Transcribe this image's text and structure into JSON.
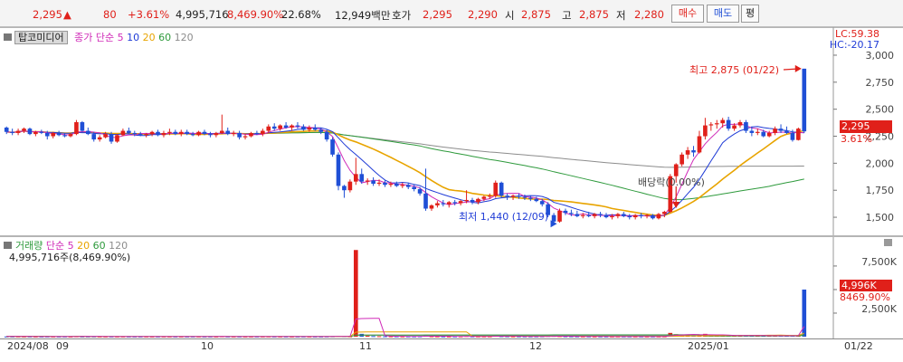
{
  "quote": {
    "price": "2,295",
    "change_arrow": "▲",
    "change": "80",
    "change_pct": "+3.61%",
    "volume": "4,995,716",
    "volume_ratio": "8,469.90%",
    "turnover_pct": "22.68%",
    "amount": "12,949백만",
    "hoga_label": "호가",
    "hoga_sell": "2,295",
    "hoga_buy": "2,290",
    "open_label": "시",
    "open": "2,875",
    "high_label": "고",
    "high": "2,875",
    "low_label": "저",
    "low": "2,280",
    "buy_label": "매수",
    "sell_label": "매도",
    "extra_label": "평"
  },
  "price_panel": {
    "stock_name": "탑코미디어",
    "legend_prefix": "종가 단순",
    "ma_periods": [
      "5",
      "10",
      "20",
      "60",
      "120"
    ],
    "lc": "LC:59.38",
    "hc": "HC:-20.17",
    "y_ticks": [
      "3,000",
      "2,750",
      "2,500",
      "2,250",
      "2,000",
      "1,750",
      "1,500"
    ],
    "current_price_tag": "2,295",
    "current_pct_tag": "3.61%",
    "high_annotation": "최고 2,875 (01/22)",
    "low_annotation": "최저 1,440 (12/09)",
    "dividend_annotation": "배당락(0.00%)"
  },
  "volume_panel": {
    "title": "거래량",
    "legend_prefix": "단순",
    "ma_periods": [
      "5",
      "20",
      "60",
      "120"
    ],
    "summary": "4,995,716주(8,469.90%)",
    "y_ticks": [
      "7,500K",
      "5,000K",
      "2,500K"
    ],
    "current_volume_tag": "4,996K",
    "current_ratio_tag": "8469.90%"
  },
  "x_axis": [
    "2024/08",
    "09",
    "10",
    "11",
    "12",
    "2025/01",
    "01/22"
  ],
  "colors": {
    "up": "#e0201a",
    "down": "#1f4fd6",
    "ma5": "#d02ab8",
    "ma10": "#1f3bd6",
    "ma20": "#e8a400",
    "ma60": "#2e9a3c",
    "ma120": "#8c8c8c"
  },
  "chart_data": {
    "type": "candlestick",
    "y_range": [
      1400,
      3050
    ],
    "candles": [
      [
        2330,
        2340,
        2270,
        2290
      ],
      [
        2290,
        2320,
        2260,
        2280
      ],
      [
        2280,
        2320,
        2260,
        2300
      ],
      [
        2300,
        2330,
        2280,
        2320
      ],
      [
        2320,
        2330,
        2260,
        2270
      ],
      [
        2270,
        2300,
        2250,
        2290
      ],
      [
        2290,
        2310,
        2270,
        2280
      ],
      [
        2280,
        2300,
        2220,
        2250
      ],
      [
        2250,
        2290,
        2230,
        2280
      ],
      [
        2280,
        2300,
        2250,
        2260
      ],
      [
        2260,
        2280,
        2240,
        2250
      ],
      [
        2250,
        2280,
        2240,
        2270
      ],
      [
        2270,
        2400,
        2260,
        2380
      ],
      [
        2380,
        2390,
        2290,
        2300
      ],
      [
        2300,
        2330,
        2260,
        2270
      ],
      [
        2270,
        2290,
        2200,
        2220
      ],
      [
        2220,
        2260,
        2200,
        2240
      ],
      [
        2240,
        2290,
        2230,
        2270
      ],
      [
        2270,
        2290,
        2180,
        2200
      ],
      [
        2200,
        2270,
        2190,
        2260
      ],
      [
        2260,
        2320,
        2250,
        2300
      ],
      [
        2300,
        2330,
        2270,
        2280
      ],
      [
        2280,
        2300,
        2250,
        2270
      ],
      [
        2270,
        2290,
        2250,
        2260
      ],
      [
        2260,
        2280,
        2240,
        2270
      ],
      [
        2270,
        2300,
        2250,
        2290
      ],
      [
        2290,
        2310,
        2250,
        2260
      ],
      [
        2260,
        2300,
        2240,
        2280
      ],
      [
        2280,
        2320,
        2260,
        2290
      ],
      [
        2290,
        2310,
        2260,
        2270
      ],
      [
        2270,
        2310,
        2250,
        2290
      ],
      [
        2290,
        2310,
        2260,
        2270
      ],
      [
        2270,
        2290,
        2250,
        2260
      ],
      [
        2260,
        2300,
        2250,
        2290
      ],
      [
        2290,
        2310,
        2260,
        2270
      ],
      [
        2270,
        2290,
        2240,
        2260
      ],
      [
        2260,
        2290,
        2240,
        2280
      ],
      [
        2280,
        2450,
        2270,
        2300
      ],
      [
        2300,
        2330,
        2260,
        2270
      ],
      [
        2270,
        2300,
        2250,
        2280
      ],
      [
        2280,
        2300,
        2220,
        2240
      ],
      [
        2240,
        2270,
        2220,
        2250
      ],
      [
        2250,
        2290,
        2240,
        2280
      ],
      [
        2280,
        2300,
        2260,
        2270
      ],
      [
        2270,
        2320,
        2250,
        2300
      ],
      [
        2300,
        2360,
        2280,
        2340
      ],
      [
        2340,
        2370,
        2300,
        2320
      ],
      [
        2320,
        2360,
        2300,
        2350
      ],
      [
        2350,
        2380,
        2320,
        2330
      ],
      [
        2330,
        2360,
        2300,
        2350
      ],
      [
        2350,
        2380,
        2320,
        2340
      ],
      [
        2340,
        2360,
        2300,
        2310
      ],
      [
        2310,
        2350,
        2290,
        2330
      ],
      [
        2330,
        2360,
        2300,
        2310
      ],
      [
        2310,
        2330,
        2270,
        2290
      ],
      [
        2290,
        2310,
        2200,
        2220
      ],
      [
        2220,
        2240,
        2060,
        2080
      ],
      [
        2080,
        2100,
        1750,
        1790
      ],
      [
        1790,
        1800,
        1680,
        1750
      ],
      [
        1750,
        1850,
        1730,
        1830
      ],
      [
        1830,
        2050,
        1800,
        1900
      ],
      [
        1900,
        1950,
        1810,
        1830
      ],
      [
        1830,
        1860,
        1800,
        1840
      ],
      [
        1840,
        1870,
        1790,
        1810
      ],
      [
        1810,
        1850,
        1790,
        1820
      ],
      [
        1820,
        1840,
        1780,
        1800
      ],
      [
        1800,
        1830,
        1780,
        1810
      ],
      [
        1810,
        1830,
        1780,
        1790
      ],
      [
        1790,
        1820,
        1770,
        1800
      ],
      [
        1800,
        1820,
        1760,
        1780
      ],
      [
        1780,
        1800,
        1740,
        1760
      ],
      [
        1760,
        1780,
        1700,
        1720
      ],
      [
        1720,
        1950,
        1560,
        1580
      ],
      [
        1580,
        1620,
        1560,
        1610
      ],
      [
        1610,
        1650,
        1590,
        1630
      ],
      [
        1630,
        1660,
        1600,
        1620
      ],
      [
        1620,
        1650,
        1590,
        1640
      ],
      [
        1640,
        1660,
        1610,
        1630
      ],
      [
        1630,
        1660,
        1610,
        1650
      ],
      [
        1650,
        1750,
        1630,
        1660
      ],
      [
        1660,
        1680,
        1620,
        1640
      ],
      [
        1640,
        1680,
        1620,
        1670
      ],
      [
        1670,
        1700,
        1650,
        1690
      ],
      [
        1690,
        1720,
        1670,
        1700
      ],
      [
        1700,
        1840,
        1680,
        1820
      ],
      [
        1820,
        1830,
        1680,
        1700
      ],
      [
        1700,
        1720,
        1660,
        1690
      ],
      [
        1690,
        1710,
        1660,
        1700
      ],
      [
        1700,
        1720,
        1670,
        1690
      ],
      [
        1690,
        1710,
        1660,
        1680
      ],
      [
        1680,
        1700,
        1650,
        1670
      ],
      [
        1670,
        1690,
        1640,
        1650
      ],
      [
        1650,
        1670,
        1600,
        1620
      ],
      [
        1620,
        1640,
        1500,
        1520
      ],
      [
        1520,
        1540,
        1440,
        1460
      ],
      [
        1460,
        1580,
        1450,
        1560
      ],
      [
        1560,
        1580,
        1520,
        1540
      ],
      [
        1540,
        1570,
        1510,
        1530
      ],
      [
        1530,
        1560,
        1500,
        1510
      ],
      [
        1510,
        1540,
        1490,
        1520
      ],
      [
        1520,
        1550,
        1500,
        1510
      ],
      [
        1510,
        1540,
        1490,
        1530
      ],
      [
        1530,
        1550,
        1500,
        1520
      ],
      [
        1520,
        1540,
        1490,
        1500
      ],
      [
        1500,
        1530,
        1480,
        1510
      ],
      [
        1510,
        1540,
        1490,
        1530
      ],
      [
        1530,
        1550,
        1500,
        1510
      ],
      [
        1510,
        1530,
        1480,
        1500
      ],
      [
        1500,
        1530,
        1480,
        1520
      ],
      [
        1520,
        1540,
        1490,
        1510
      ],
      [
        1510,
        1530,
        1490,
        1520
      ],
      [
        1520,
        1530,
        1480,
        1490
      ],
      [
        1490,
        1540,
        1480,
        1530
      ],
      [
        1530,
        1560,
        1500,
        1550
      ],
      [
        1550,
        1900,
        1540,
        1880
      ],
      [
        1880,
        2000,
        1820,
        1990
      ],
      [
        1990,
        2100,
        1970,
        2080
      ],
      [
        2080,
        2150,
        2040,
        2120
      ],
      [
        2120,
        2160,
        2060,
        2100
      ],
      [
        2100,
        2300,
        2090,
        2250
      ],
      [
        2250,
        2420,
        2220,
        2350
      ],
      [
        2350,
        2380,
        2300,
        2360
      ],
      [
        2360,
        2400,
        2320,
        2370
      ],
      [
        2370,
        2420,
        2330,
        2400
      ],
      [
        2400,
        2430,
        2300,
        2320
      ],
      [
        2320,
        2370,
        2300,
        2350
      ],
      [
        2350,
        2400,
        2330,
        2380
      ],
      [
        2380,
        2400,
        2280,
        2300
      ],
      [
        2300,
        2340,
        2250,
        2280
      ],
      [
        2280,
        2320,
        2260,
        2290
      ],
      [
        2290,
        2310,
        2240,
        2250
      ],
      [
        2250,
        2300,
        2240,
        2280
      ],
      [
        2280,
        2340,
        2260,
        2320
      ],
      [
        2320,
        2360,
        2280,
        2300
      ],
      [
        2300,
        2340,
        2270,
        2280
      ],
      [
        2280,
        2310,
        2200,
        2215
      ],
      [
        2215,
        2330,
        2210,
        2320
      ],
      [
        2875,
        2875,
        2280,
        2295
      ]
    ],
    "volume_x1000": [
      20,
      15,
      18,
      12,
      14,
      10,
      12,
      16,
      11,
      10,
      12,
      9,
      30,
      14,
      12,
      15,
      11,
      10,
      13,
      12,
      14,
      11,
      10,
      9,
      12,
      10,
      11,
      13,
      12,
      10,
      11,
      9,
      12,
      14,
      10,
      11,
      9,
      30,
      12,
      10,
      11,
      9,
      10,
      12,
      14,
      18,
      12,
      11,
      10,
      9,
      12,
      13,
      11,
      10,
      9,
      18,
      30,
      60,
      40,
      30,
      9200,
      300,
      90,
      60,
      50,
      40,
      35,
      30,
      25,
      22,
      20,
      30,
      120,
      40,
      30,
      25,
      22,
      20,
      25,
      60,
      25,
      20,
      22,
      25,
      150,
      40,
      30,
      25,
      22,
      20,
      18,
      20,
      30,
      60,
      80,
      50,
      30,
      25,
      20,
      18,
      16,
      15,
      14,
      13,
      12,
      15,
      14,
      12,
      13,
      12,
      11,
      12,
      14,
      20,
      400,
      260,
      200,
      180,
      160,
      220,
      300,
      150,
      140,
      130,
      110,
      120,
      140,
      120,
      110,
      100,
      90,
      95,
      110,
      100,
      90,
      100,
      120,
      5000
    ],
    "volume_y_range": [
      0,
      9800
    ]
  }
}
